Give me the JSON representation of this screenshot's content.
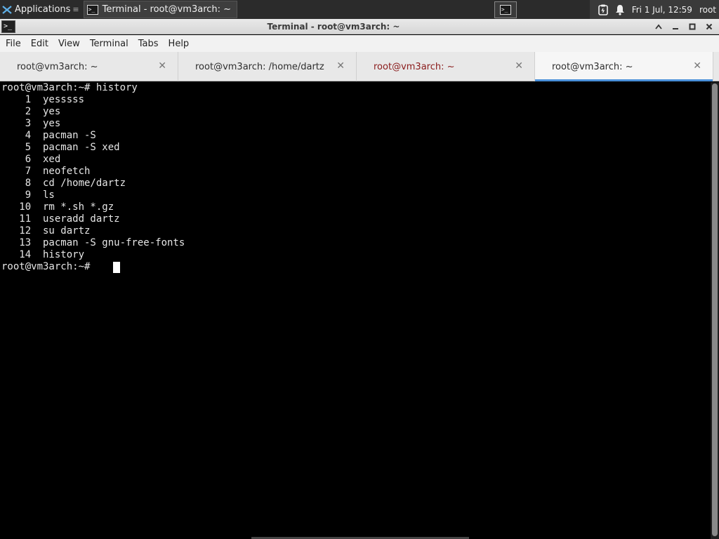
{
  "panel": {
    "applications_label": "Applications",
    "task_title": "Terminal - root@vm3arch: ~",
    "clock": "Fri 1 Jul, 12:59",
    "user": "root"
  },
  "window": {
    "title": "Terminal - root@vm3arch: ~",
    "terminal_icon_text": ">_"
  },
  "menu": [
    "File",
    "Edit",
    "View",
    "Terminal",
    "Tabs",
    "Help"
  ],
  "tabs": [
    {
      "label": "root@vm3arch: ~",
      "state": "normal"
    },
    {
      "label": "root@vm3arch: /home/dartz",
      "state": "normal"
    },
    {
      "label": "root@vm3arch: ~",
      "state": "alert"
    },
    {
      "label": "root@vm3arch: ~",
      "state": "active"
    }
  ],
  "terminal": {
    "lines": [
      "root@vm3arch:~# history",
      "    1  yesssss",
      "    2  yes",
      "    3  yes",
      "    4  pacman -S",
      "    5  pacman -S xed",
      "    6  xed",
      "    7  neofetch",
      "    8  cd /home/dartz",
      "    9  ls",
      "   10  rm *.sh *.gz",
      "   11  useradd dartz",
      "   12  su dartz",
      "   13  pacman -S gnu-free-fonts",
      "   14  history",
      "root@vm3arch:~# "
    ]
  },
  "colors": {
    "tab_accent": "#4a90d9",
    "alert_tab_text": "#8a1b1b",
    "terminal_bg": "#000000",
    "terminal_fg": "#e6e6e6"
  }
}
